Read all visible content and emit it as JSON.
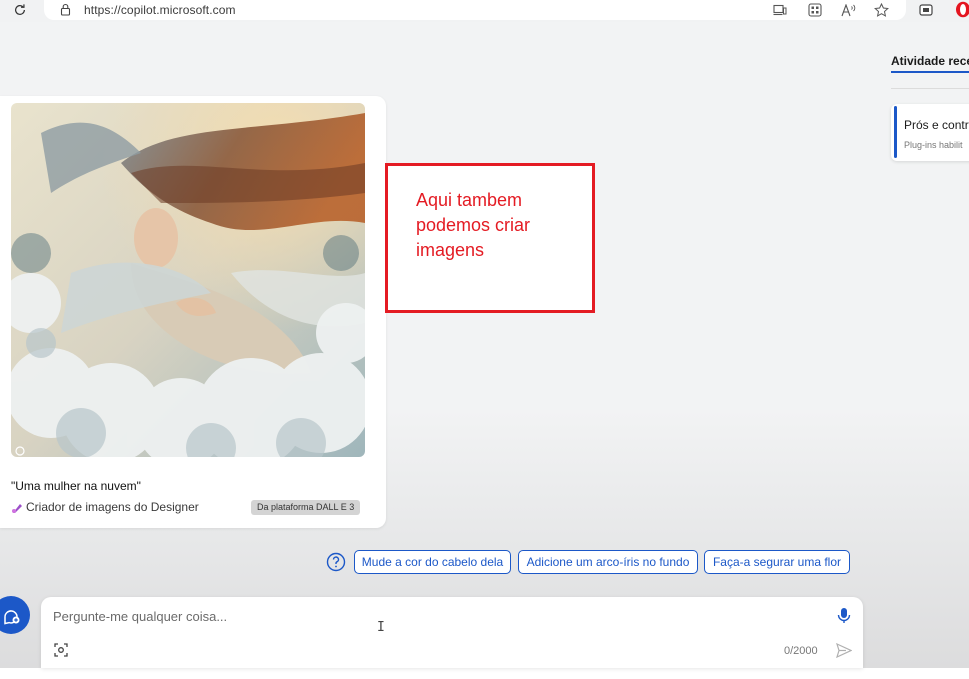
{
  "browser": {
    "url": "https://copilot.microsoft.com",
    "icons": [
      "reload-icon",
      "lock-icon",
      "device-icon",
      "apps-icon",
      "read-aloud-icon",
      "favorite-star-icon",
      "wallet-icon",
      "opera-icon"
    ]
  },
  "image_card": {
    "caption": "\"Uma mulher na nuvem\"",
    "creator_label": "Criador de imagens do Designer",
    "platform_badge": "Da plataforma DALL E 3"
  },
  "annotation": {
    "text": "Aqui tambem podemos criar imagens",
    "color": "#e41b23"
  },
  "recent_activity": {
    "tab_label": "Atividade recen",
    "item_title": "Prós e contra",
    "item_subtitle": "Plug-ins habilit"
  },
  "suggestions": [
    "Mude a cor do cabelo dela",
    "Adicione um arco-íris no fundo",
    "Faça-a segurar uma flor"
  ],
  "chat_input": {
    "placeholder": "Pergunte-me qualquer coisa...",
    "char_count": "0/2000"
  },
  "colors": {
    "accent": "#1c58c8",
    "annotation": "#e41b23",
    "background": "#f1f2f3"
  }
}
